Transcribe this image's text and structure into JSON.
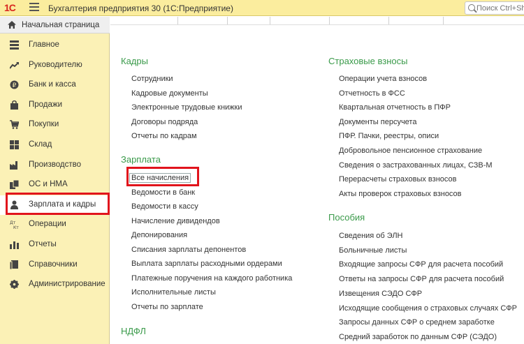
{
  "titlebar": {
    "logo": "1С",
    "title": "Бухгалтерия предприятия 30  (1С:Предприятие)",
    "search_placeholder": "Поиск Ctrl+Sh"
  },
  "sidebar": {
    "home": "Начальная страница",
    "items": [
      {
        "label": "Главное",
        "icon": "list-icon"
      },
      {
        "label": "Руководителю",
        "icon": "trend-icon"
      },
      {
        "label": "Банк и касса",
        "icon": "coin-icon"
      },
      {
        "label": "Продажи",
        "icon": "bag-icon"
      },
      {
        "label": "Покупки",
        "icon": "cart-icon"
      },
      {
        "label": "Склад",
        "icon": "warehouse-icon"
      },
      {
        "label": "Производство",
        "icon": "factory-icon"
      },
      {
        "label": "ОС и НМА",
        "icon": "assets-icon"
      },
      {
        "label": "Зарплата и кадры",
        "icon": "person-icon"
      },
      {
        "label": "Операции",
        "icon": "operations-icon"
      },
      {
        "label": "Отчеты",
        "icon": "reports-icon"
      },
      {
        "label": "Справочники",
        "icon": "book-icon"
      },
      {
        "label": "Администрирование",
        "icon": "gear-icon"
      }
    ]
  },
  "content": {
    "left": {
      "kadry": {
        "title": "Кадры",
        "links": [
          "Сотрудники",
          "Кадровые документы",
          "Электронные трудовые книжки",
          "Договоры подряда",
          "Отчеты по кадрам"
        ]
      },
      "zarplata": {
        "title": "Зарплата",
        "links": [
          "Все начисления",
          "Ведомости в банк",
          "Ведомости в кассу",
          "Начисление дивидендов",
          "Депонирования",
          "Списания зарплаты депонентов",
          "Выплата зарплаты расходными ордерами",
          "Платежные поручения на каждого работника",
          "Исполнительные листы",
          "Отчеты по зарплате"
        ]
      },
      "ndfl": {
        "title": "НДФЛ"
      }
    },
    "right": {
      "vznosy": {
        "title": "Страховые взносы",
        "links": [
          "Операции учета взносов",
          "Отчетность в ФСС",
          "Квартальная отчетность в ПФР",
          "Документы персучета",
          "ПФР. Пачки, реестры, описи",
          "Добровольное пенсионное страхование",
          "Сведения о застрахованных лицах, СЗВ-М",
          "Перерасчеты страховых взносов",
          "Акты проверок страховых взносов"
        ]
      },
      "posobiya": {
        "title": "Пособия",
        "links": [
          "Сведения об ЭЛН",
          "Больничные листы",
          "Входящие запросы СФР для расчета пособий",
          "Ответы на запросы СФР для расчета пособий",
          "Извещения СЭДО СФР",
          "Исходящие сообщения о страховых случаях СФР",
          "Запросы данных СФР о среднем заработке",
          "Средний заработок по данным СФР (СЭДО)"
        ]
      }
    }
  },
  "colors": {
    "titlebar": "#fbed9e",
    "sidebar": "#fbf1b6",
    "group_title": "#3a9a4a",
    "highlight": "#e1141c",
    "logo": "#d8261f"
  }
}
